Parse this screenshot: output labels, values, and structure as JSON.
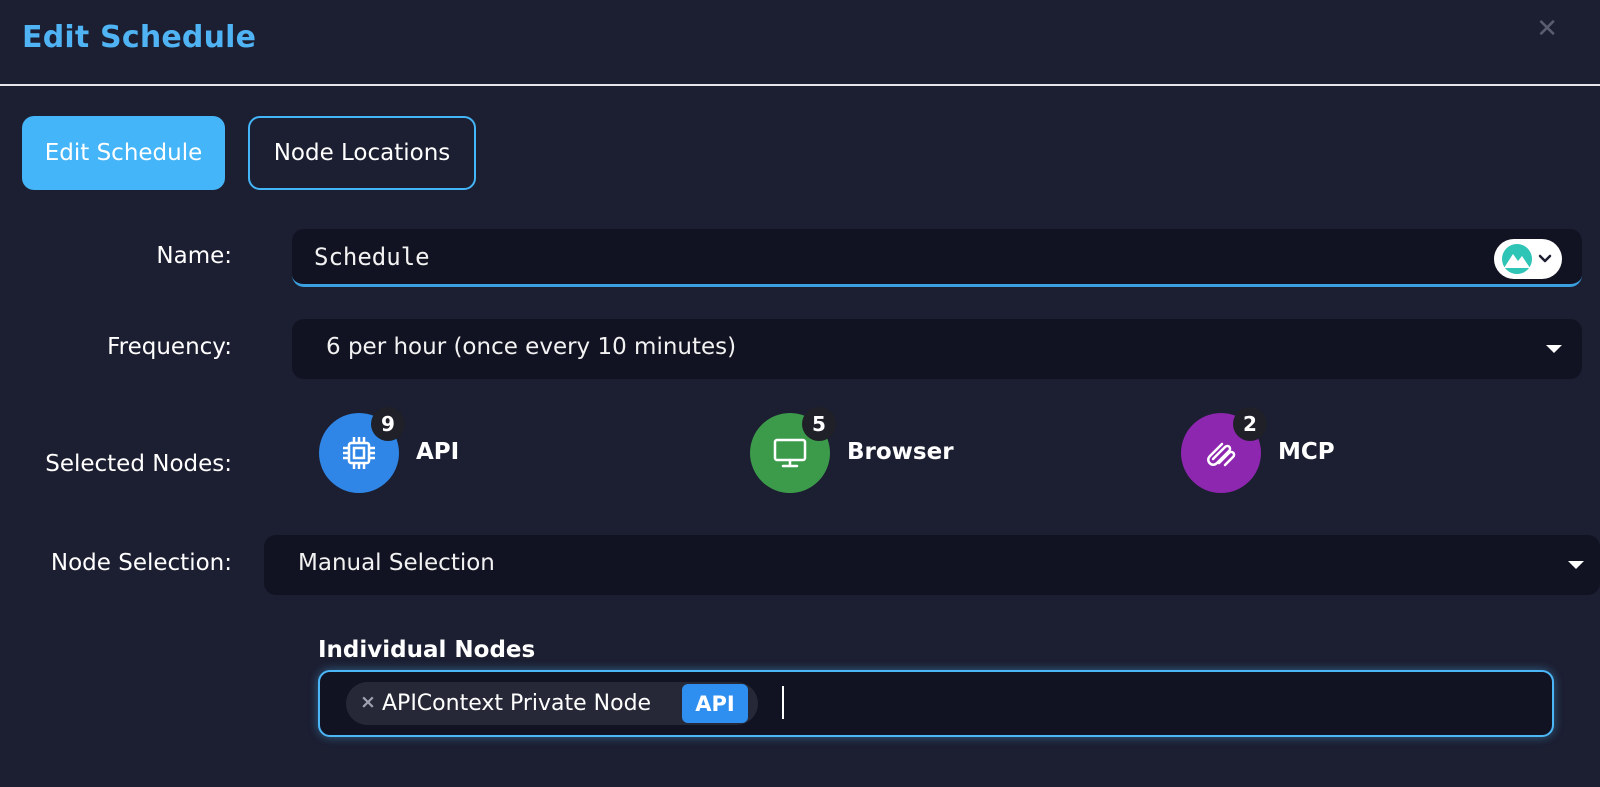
{
  "dialog": {
    "title": "Edit Schedule",
    "close_icon": "close-icon"
  },
  "tabs": [
    {
      "label": "Edit Schedule",
      "active": true
    },
    {
      "label": "Node Locations",
      "active": false
    }
  ],
  "form": {
    "name_label": "Name:",
    "name_value": "Schedule",
    "frequency_label": "Frequency:",
    "frequency_value": "6 per hour (once every 10 minutes)",
    "selected_nodes_label": "Selected Nodes:",
    "node_selection_label": "Node Selection:",
    "node_selection_value": "Manual Selection"
  },
  "selected_nodes": [
    {
      "label": "API",
      "count": "9",
      "icon": "cpu-chip-icon",
      "color": "#2f86e6"
    },
    {
      "label": "Browser",
      "count": "5",
      "icon": "monitor-icon",
      "color": "#3c9b4a"
    },
    {
      "label": "MCP",
      "count": "2",
      "icon": "paperclip-icon",
      "color": "#8e27b0"
    }
  ],
  "individual_nodes": {
    "title": "Individual Nodes",
    "chips": [
      {
        "label": "APIContext Private Node",
        "tag": "API"
      }
    ]
  },
  "colors": {
    "accent": "#44b5f8",
    "background": "#1c1e31",
    "field": "#121322"
  }
}
